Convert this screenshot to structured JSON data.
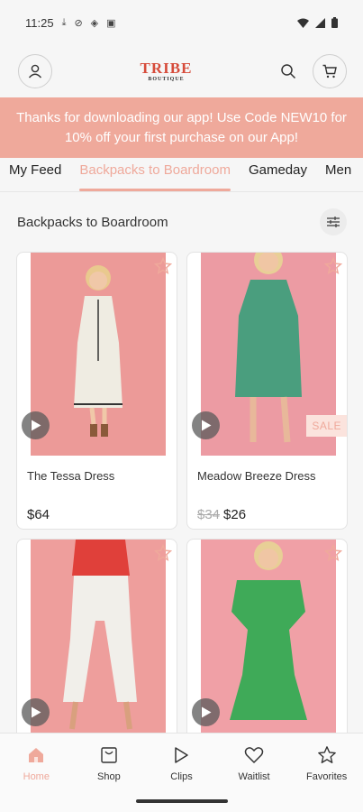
{
  "status_bar": {
    "time": "11:25"
  },
  "header": {
    "logo": "TRIBE",
    "logo_sub": "BOUTIQUE"
  },
  "promo": {
    "text": "Thanks for downloading our app! Use Code NEW10 for 10% off your first purchase on our App!"
  },
  "tabs": [
    {
      "label": "My Feed"
    },
    {
      "label": "Backpacks to Boardroom"
    },
    {
      "label": "Gameday"
    },
    {
      "label": "Men"
    }
  ],
  "section": {
    "title": "Backpacks to Boardroom"
  },
  "products": [
    {
      "name": "The Tessa Dress",
      "price": "$64",
      "old_price": "",
      "sale": "",
      "colors": {
        "bg": "#ec9a98",
        "dress": "#efece2"
      }
    },
    {
      "name": "Meadow Breeze Dress",
      "price": "$26",
      "old_price": "$34",
      "sale": "SALE",
      "colors": {
        "bg": "#ec9ba3",
        "dress": "#4a9e7e"
      }
    },
    {
      "name": "",
      "price": "",
      "old_price": "",
      "sale": "",
      "colors": {
        "bg": "#ee9e9c",
        "top": "#e0403a",
        "pants": "#f1efea"
      }
    },
    {
      "name": "",
      "price": "",
      "old_price": "",
      "sale": "",
      "colors": {
        "bg": "#f0a0a6",
        "dress": "#3faa58"
      }
    }
  ],
  "bottom_nav": [
    {
      "label": "Home",
      "icon": "home-icon",
      "active": true
    },
    {
      "label": "Shop",
      "icon": "shop-icon",
      "active": false
    },
    {
      "label": "Clips",
      "icon": "play-icon",
      "active": false
    },
    {
      "label": "Waitlist",
      "icon": "heart-icon",
      "active": false
    },
    {
      "label": "Favorites",
      "icon": "star-icon",
      "active": false
    }
  ],
  "theme": {
    "accent": "#efa99b"
  }
}
